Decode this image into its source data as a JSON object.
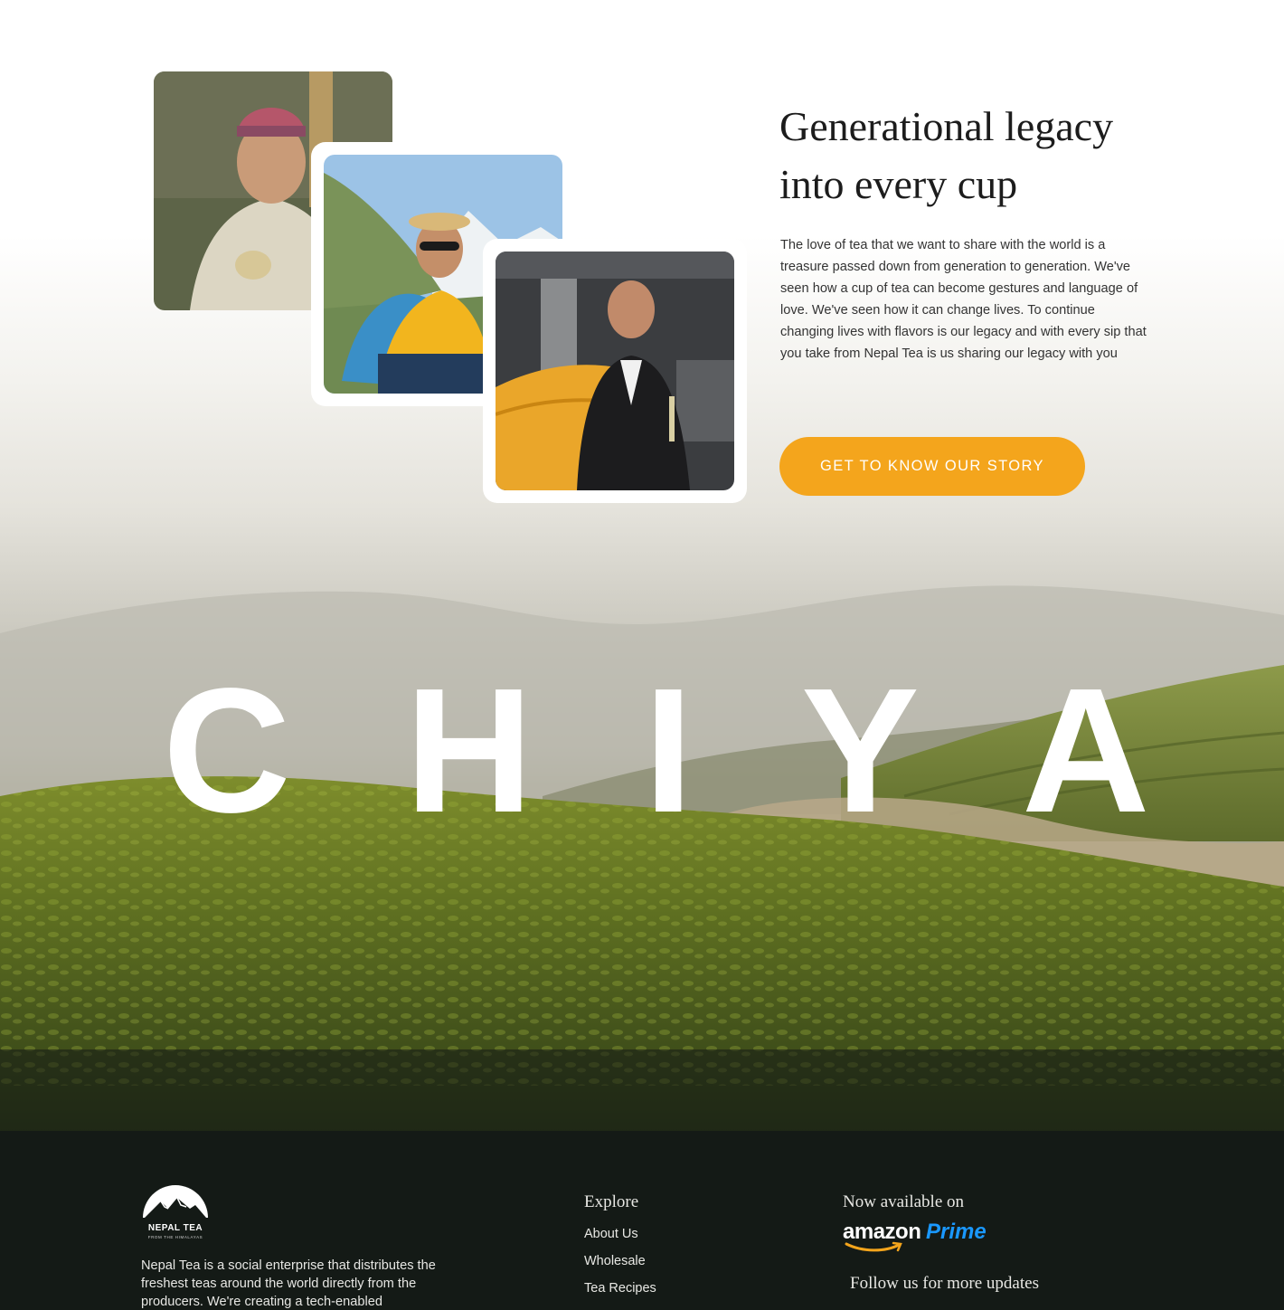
{
  "story": {
    "headline": "Generational legacy into every cup",
    "body": "The love of tea that we want to share with the world is a treasure passed down from generation to generation. We've seen how a cup of tea can become gestures and language of love. We've seen how it can change lives. To continue changing lives with flavors is our legacy and with every sip that you take from Nepal Tea is us sharing our legacy with you",
    "cta_label": "GET TO KNOW OUR STORY"
  },
  "hero": {
    "letters": [
      "C",
      "H",
      "I",
      "Y",
      "A"
    ]
  },
  "footer": {
    "logo_name": "NEPAL TEA",
    "logo_tagline": "FROM THE HIMALAYAS",
    "about": "Nepal Tea is a social enterprise that distributes the freshest teas around the world directly from the producers. We're creating a tech-enabled",
    "explore_heading": "Explore",
    "explore_links": [
      "About Us",
      "Wholesale",
      "Tea Recipes"
    ],
    "available_heading": "Now available on",
    "amazon_word": "amazon",
    "prime_word": "Prime",
    "follow_heading": "Follow us for more updates"
  },
  "colors": {
    "accent": "#f4a51c",
    "footer_bg": "#141a16",
    "prime_blue": "#1a98ff"
  }
}
